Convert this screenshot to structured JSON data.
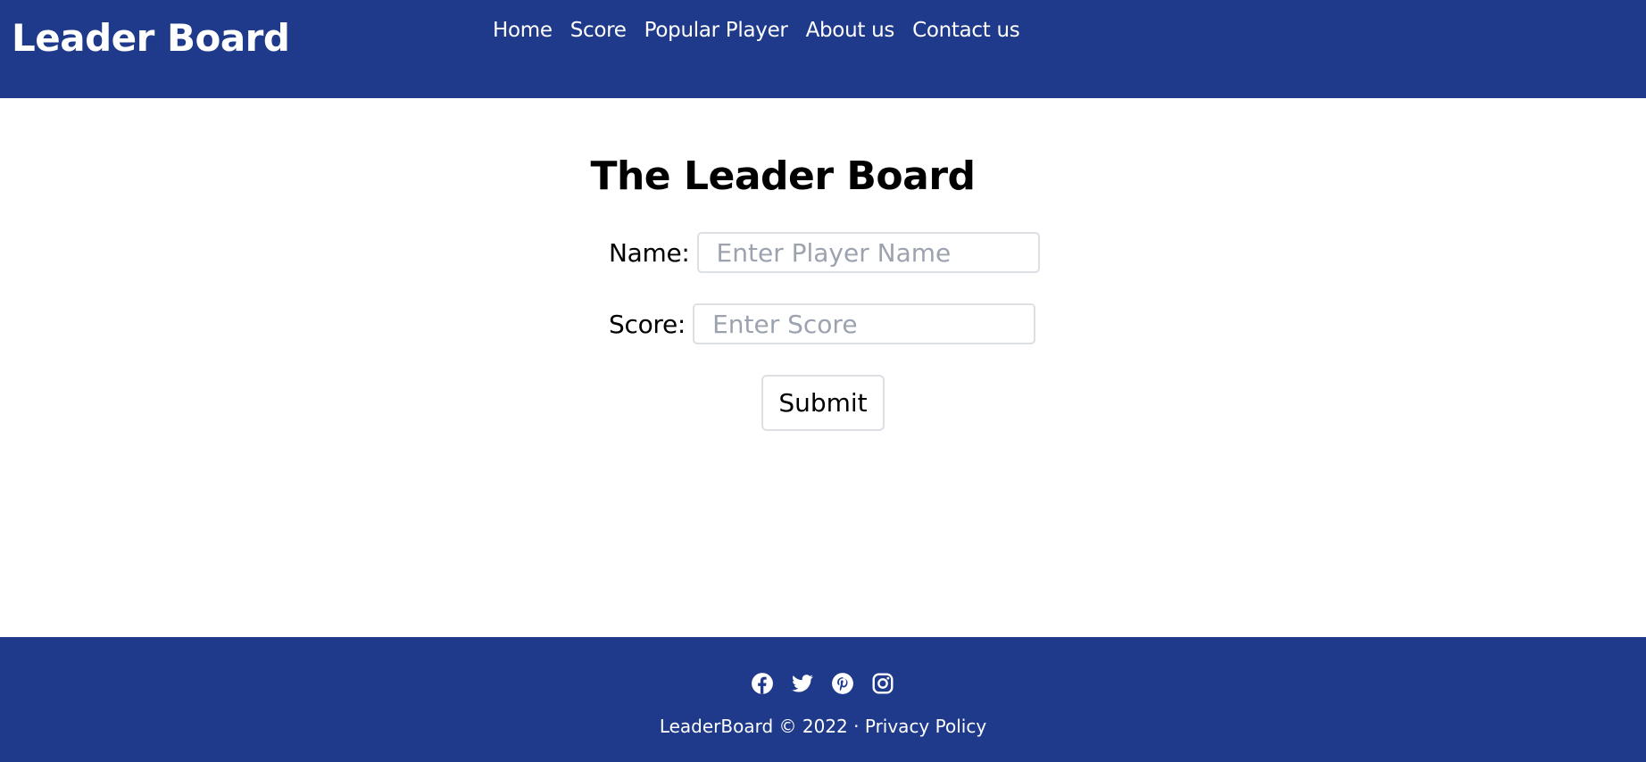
{
  "header": {
    "brand": "Leader Board",
    "nav": [
      {
        "label": "Home"
      },
      {
        "label": "Score"
      },
      {
        "label": "Popular Player"
      },
      {
        "label": "About us"
      },
      {
        "label": "Contact us"
      }
    ]
  },
  "main": {
    "title": "The Leader Board",
    "name_label": "Name:",
    "name_placeholder": "Enter Player Name",
    "name_value": "",
    "score_label": "Score:",
    "score_placeholder": "Enter Score",
    "score_value": "",
    "submit_label": "Submit"
  },
  "footer": {
    "social_icons": [
      "facebook-icon",
      "twitter-icon",
      "pinterest-icon",
      "instagram-icon"
    ],
    "copyright": "LeaderBoard © 2022 ·",
    "privacy_label": "Privacy Policy"
  },
  "colors": {
    "primary": "#1f3a8a",
    "text_on_primary": "#ffffff",
    "input_border": "#dcdfe4",
    "placeholder": "#9ca3af"
  }
}
